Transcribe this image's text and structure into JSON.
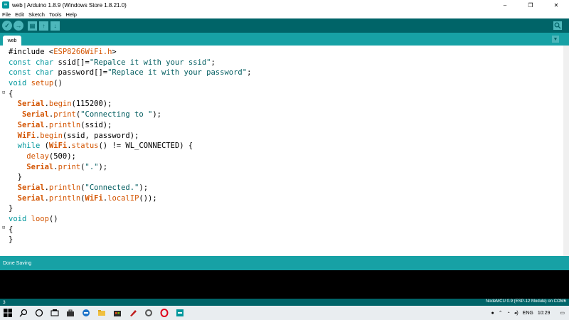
{
  "window": {
    "title": "web | Arduino 1.8.9 (Windows Store 1.8.21.0)",
    "minimize": "–",
    "maximize": "❐",
    "close": "✕"
  },
  "menu": [
    "File",
    "Edit",
    "Sketch",
    "Tools",
    "Help"
  ],
  "toolbar": {
    "verify_icon": "✓",
    "upload_icon": "→",
    "new_icon": "▤",
    "open_icon": "↑",
    "save_icon": "↓",
    "serial_icon": "⌕"
  },
  "tabs": {
    "active": "web",
    "menu_icon": "▼"
  },
  "code_lines": [
    "#include <ESP8266WiFi.h>",
    "const char ssid[]=\"Repalce it with your ssid\";",
    "const char password[]=\"Replace it with your password\";",
    "void setup()",
    "{",
    "  Serial.begin(115200);",
    "   Serial.print(\"Connecting to \");",
    "  Serial.println(ssid);",
    "  WiFi.begin(ssid, password);",
    "  while (WiFi.status() != WL_CONNECTED) {",
    "    delay(500);",
    "    Serial.print(\".\");",
    "  }",
    "  Serial.println(\"Connected.\");",
    "  Serial.println(WiFi.localIP());",
    "}",
    "void loop()",
    "{",
    "}"
  ],
  "status": {
    "message": "Done Saving"
  },
  "footer": {
    "line": "3",
    "board": "NodeMCU 0.9 (ESP-12 Module) on COM6"
  },
  "taskbar": {
    "start_icon": "⊞",
    "search_icon": "⚲",
    "cortana_icon": "○",
    "tray_lang": "ENG",
    "time": "10:29"
  },
  "colors": {
    "toolbar": "#006468",
    "tabbar": "#17a1a5",
    "keyword": "#00979c",
    "object": "#d35400"
  }
}
